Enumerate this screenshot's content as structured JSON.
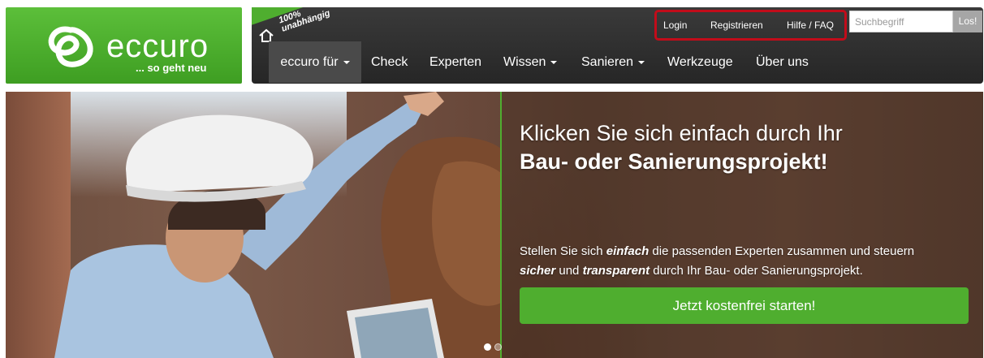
{
  "logo": {
    "brand": "eccuro",
    "tagline": "... so geht neu",
    "ribbon_line1": "100%",
    "ribbon_line2": "unabhängig"
  },
  "utility_nav": {
    "login": "Login",
    "register": "Registrieren",
    "help": "Hilfe / FAQ"
  },
  "search": {
    "placeholder": "Suchbegriff",
    "button": "Los!"
  },
  "main_nav": [
    {
      "label": "eccuro für",
      "has_dropdown": true,
      "active": true
    },
    {
      "label": "Check",
      "has_dropdown": false
    },
    {
      "label": "Experten",
      "has_dropdown": false
    },
    {
      "label": "Wissen",
      "has_dropdown": true
    },
    {
      "label": "Sanieren",
      "has_dropdown": true
    },
    {
      "label": "Werkzeuge",
      "has_dropdown": false
    },
    {
      "label": "Über uns",
      "has_dropdown": false
    }
  ],
  "hero": {
    "headline_1": "Klicken Sie sich einfach durch Ihr",
    "headline_2": "Bau- oder Sanierungsprojekt!",
    "text_1": "Stellen Sie sich ",
    "text_em_1": "einfach",
    "text_2": " die passenden Experten zusammen und steuern",
    "text_em_2": "sicher",
    "text_3": " und ",
    "text_em_3": "transparent",
    "text_4": " durch Ihr Bau- oder Sanierungsprojekt.",
    "cta": "Jetzt kostenfrei starten!",
    "slides": 2,
    "active_slide": 0
  },
  "colors": {
    "brand_green": "#4fae2f",
    "nav_dark": "#2f2f2f",
    "highlight_red": "#c20c1a"
  }
}
